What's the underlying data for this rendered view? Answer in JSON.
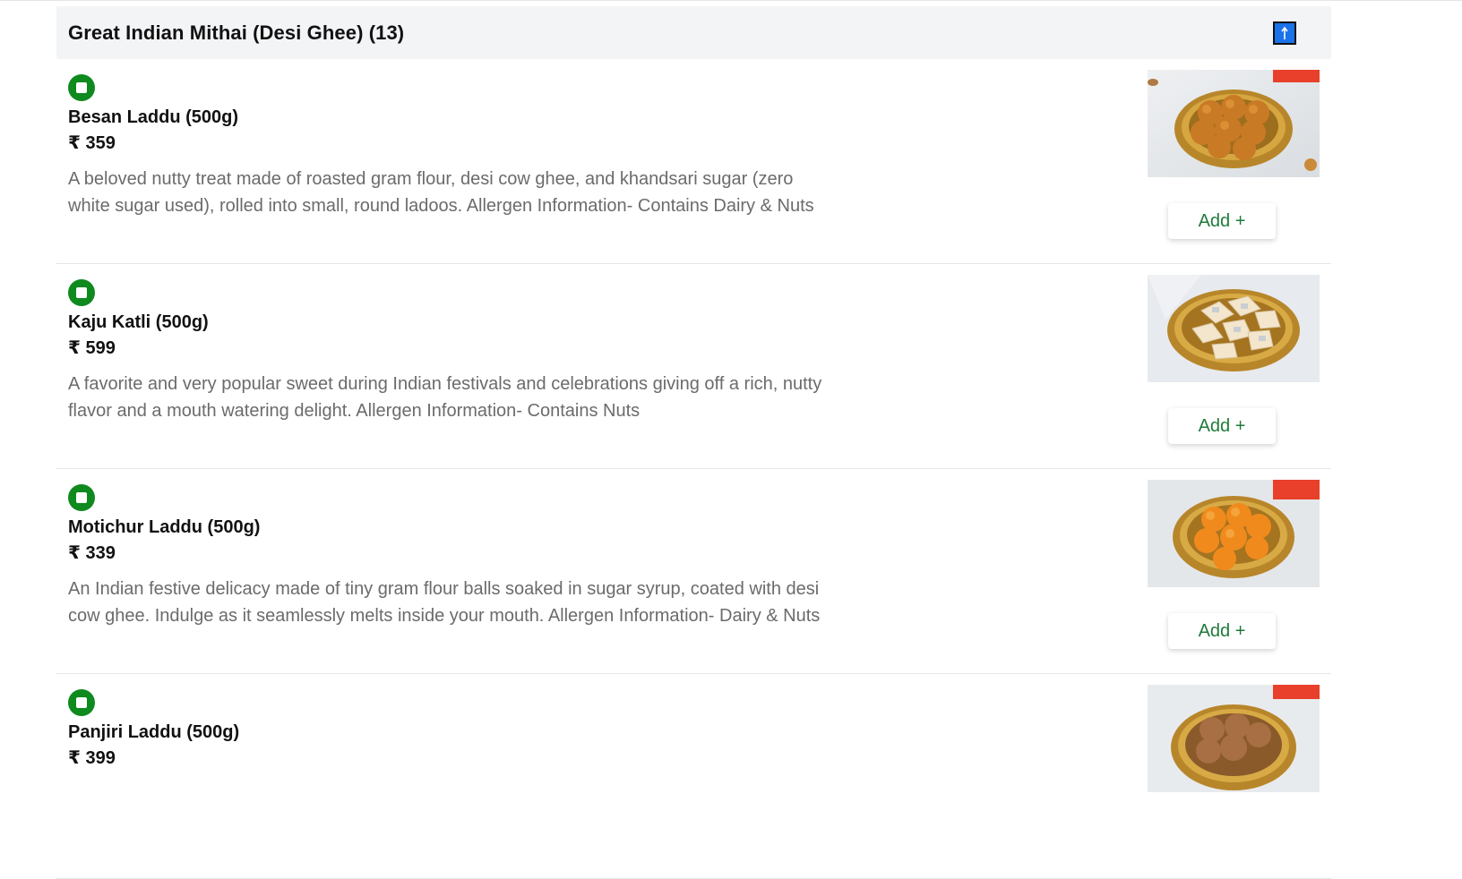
{
  "section": {
    "title": "Great Indian Mithai (Desi Ghee) (13)",
    "scroll_top_icon": "arrow-up-icon"
  },
  "items": [
    {
      "name": "Besan Laddu (500g)",
      "price": "₹ 359",
      "description": "A beloved nutty treat made of roasted gram flour, desi cow ghee, and khandsari sugar (zero white sugar used), rolled into small, round ladoos. Allergen Information- Contains Dairy & Nuts",
      "veg_icon": "veg-indicator-icon",
      "add_label": "Add +"
    },
    {
      "name": "Kaju Katli (500g)",
      "price": "₹ 599",
      "description": "A favorite and very popular sweet during Indian festivals and celebrations giving off a rich, nutty flavor and a mouth watering delight. Allergen Information- Contains Nuts",
      "veg_icon": "veg-indicator-icon",
      "add_label": "Add +"
    },
    {
      "name": "Motichur Laddu (500g)",
      "price": "₹ 339",
      "description": "An Indian festive delicacy made of tiny gram flour balls soaked in sugar syrup, coated with desi cow ghee. Indulge as it seamlessly melts inside your mouth. Allergen Information- Dairy & Nuts",
      "veg_icon": "veg-indicator-icon",
      "add_label": "Add +"
    },
    {
      "name": "Panjiri Laddu (500g)",
      "price": "₹ 399",
      "description": "",
      "veg_icon": "veg-indicator-icon",
      "add_label": ""
    }
  ],
  "colors": {
    "veg_green": "#0f8a1e",
    "add_text": "#1f7a3a",
    "header_bg": "#f3f4f6",
    "scroll_button": "#1a73e8"
  }
}
